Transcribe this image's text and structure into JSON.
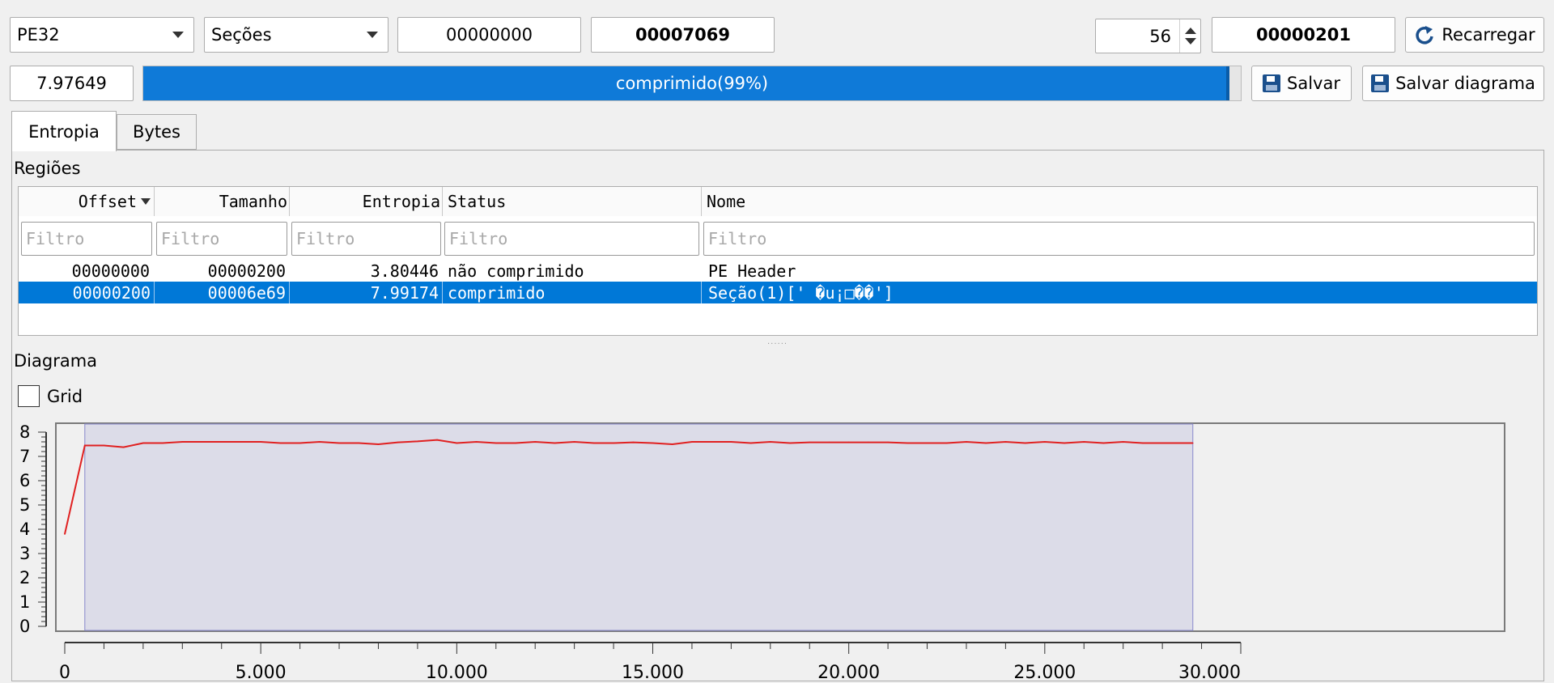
{
  "toolbar": {
    "file_type": "PE32",
    "region_mode": "Seções",
    "offset": "00000000",
    "size": "00007069",
    "count": "56",
    "block_size": "00000201",
    "reload_label": "Recarregar"
  },
  "summary": {
    "total_entropy": "7.97649",
    "status_text": "comprimido(99%)",
    "progress_percent": 99,
    "save_label": "Salvar",
    "save_diagram_label": "Salvar diagrama"
  },
  "tabs": [
    {
      "label": "Entropia",
      "active": true
    },
    {
      "label": "Bytes",
      "active": false
    }
  ],
  "regions": {
    "title": "Regiões",
    "columns": [
      "Offset",
      "Tamanho",
      "Entropia",
      "Status",
      "Nome"
    ],
    "filter_placeholder": "Filtro",
    "rows": [
      {
        "offset": "00000000",
        "size": "00000200",
        "entropy": "3.80446",
        "status": "não comprimido",
        "name": "PE Header"
      },
      {
        "offset": "00000200",
        "size": "00006e69",
        "entropy": "7.99174",
        "status": "comprimido",
        "name": "Seção(1)[' �u¡□��']"
      }
    ]
  },
  "diagram": {
    "title": "Diagrama",
    "grid_label": "Grid",
    "grid_checked": false
  },
  "colors": {
    "accent": "#0078d7",
    "progress": "#0f7ad8",
    "line": "#e02020",
    "region_fill": "#dcdce8",
    "region_border": "#8888cc"
  },
  "chart_data": {
    "type": "line",
    "title": "",
    "xlabel": "",
    "ylabel": "",
    "xlim": [
      0,
      30000
    ],
    "ylim": [
      0,
      8
    ],
    "x_ticks": [
      "0",
      "5.000",
      "10.000",
      "15.000",
      "20.000",
      "25.000",
      "30.000"
    ],
    "x_tick_values": [
      0,
      5000,
      10000,
      15000,
      20000,
      25000,
      30000
    ],
    "y_ticks": [
      "0",
      "1",
      "2",
      "3",
      "4",
      "5",
      "6",
      "7",
      "8"
    ],
    "y_tick_values": [
      0,
      1,
      2,
      3,
      4,
      5,
      6,
      7,
      8
    ],
    "grid": false,
    "region": {
      "x_start": 512,
      "x_end": 28777
    },
    "series": [
      {
        "x": [
          0,
          512,
          1000,
          1500,
          2000,
          2500,
          3000,
          3500,
          4000,
          4500,
          5000,
          5500,
          6000,
          6500,
          7000,
          7500,
          8000,
          8500,
          9000,
          9500,
          10000,
          10500,
          11000,
          11500,
          12000,
          12500,
          13000,
          13500,
          14000,
          14500,
          15000,
          15500,
          16000,
          16500,
          17000,
          17500,
          18000,
          18500,
          19000,
          19500,
          20000,
          20500,
          21000,
          21500,
          22000,
          22500,
          23000,
          23500,
          24000,
          24500,
          25000,
          25500,
          26000,
          26500,
          27000,
          27500,
          28000,
          28777
        ],
        "values": [
          3.8,
          7.45,
          7.45,
          7.38,
          7.55,
          7.55,
          7.6,
          7.6,
          7.6,
          7.6,
          7.6,
          7.55,
          7.55,
          7.6,
          7.55,
          7.55,
          7.5,
          7.58,
          7.62,
          7.68,
          7.55,
          7.6,
          7.55,
          7.55,
          7.6,
          7.55,
          7.6,
          7.55,
          7.55,
          7.58,
          7.55,
          7.5,
          7.6,
          7.6,
          7.6,
          7.55,
          7.6,
          7.55,
          7.58,
          7.58,
          7.58,
          7.58,
          7.58,
          7.55,
          7.55,
          7.55,
          7.6,
          7.55,
          7.6,
          7.55,
          7.6,
          7.55,
          7.6,
          7.55,
          7.6,
          7.55,
          7.55,
          7.55
        ]
      }
    ]
  }
}
